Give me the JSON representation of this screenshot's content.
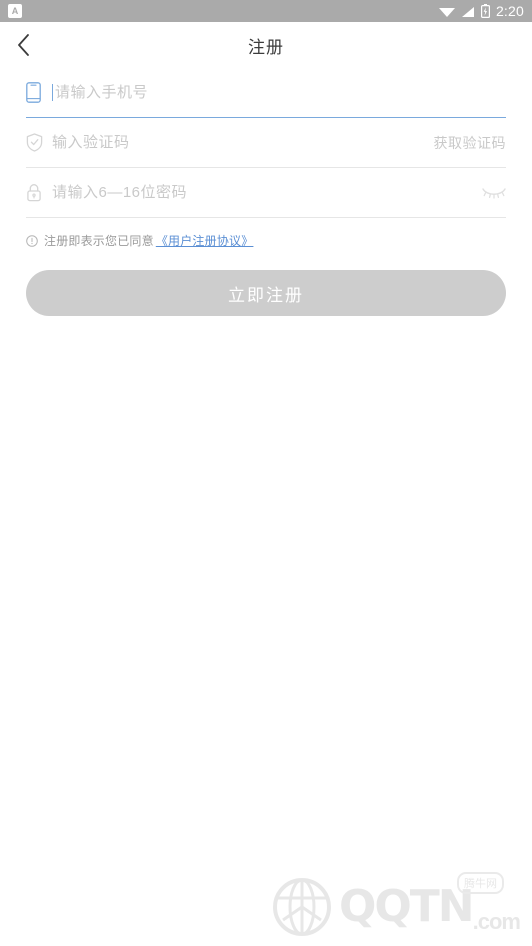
{
  "status_bar": {
    "app_badge_glyph": "A",
    "icons": [
      "wifi-icon",
      "signal-icon",
      "battery-charging-icon"
    ],
    "time": "2:20",
    "background": "#aaaaaa"
  },
  "titlebar": {
    "back_icon": "chevron-left-icon",
    "title": "注册"
  },
  "form": {
    "phone": {
      "icon": "mobile-phone-icon",
      "placeholder": "请输入手机号",
      "value": "",
      "focused": true,
      "underline_color": "#7aa9dd",
      "icon_color": "#7aa9dd"
    },
    "code": {
      "icon": "shield-check-icon",
      "placeholder": "输入验证码",
      "value": "",
      "action_label": "获取验证码",
      "underline_color": "#e6e6e6"
    },
    "password": {
      "icon": "lock-icon",
      "placeholder": "请输入6—16位密码",
      "value": "",
      "toggle_icon": "eye-off-icon",
      "underline_color": "#e6e6e6"
    }
  },
  "agreement": {
    "icon": "info-circle-icon",
    "text": "注册即表示您已同意",
    "link_text": "《用户注册协议》",
    "link_color": "#5b8fd4"
  },
  "submit": {
    "label": "立即注册",
    "enabled": false,
    "background": "#cdcdcd",
    "text_color": "#ffffff"
  },
  "watermark": {
    "logo": "globe-logo-icon",
    "brand": "QQTN",
    "suffix": ".com",
    "badge": "腾牛网"
  }
}
